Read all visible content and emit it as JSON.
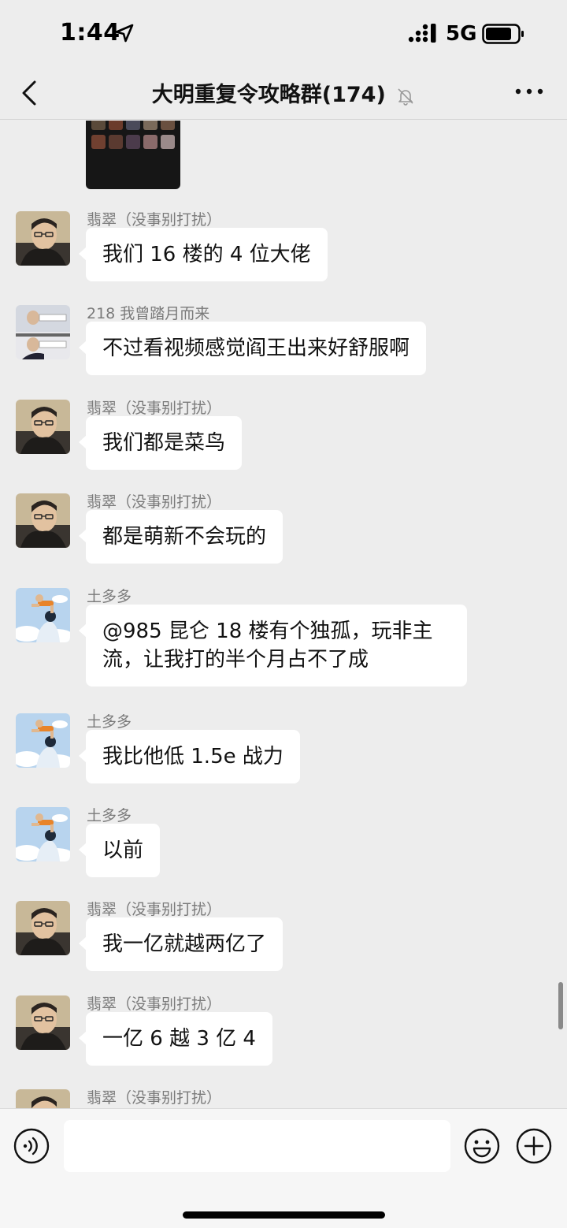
{
  "status_bar": {
    "time": "1:44",
    "network": "5G",
    "icons": [
      "location-arrow-icon",
      "signal-bars-icon",
      "battery-icon"
    ]
  },
  "nav": {
    "back_icon": "chevron-left-icon",
    "title": "大明重复令攻略群(174)",
    "mute_icon": "bell-slash-icon",
    "more_icon": "ellipsis-icon"
  },
  "messages": [
    {
      "sender": "翡翠（没事别打扰）",
      "text": "我们 16 楼的 4 位大佬"
    },
    {
      "sender": "218 我曾踏月而来",
      "text": "不过看视频感觉阎王出来好舒服啊"
    },
    {
      "sender": "翡翠（没事别打扰）",
      "text": "我们都是菜鸟"
    },
    {
      "sender": "翡翠（没事别打扰）",
      "text": "都是萌新不会玩的"
    },
    {
      "sender": "土多多",
      "text": "@985 昆仑 18 楼有个独孤，玩非主流，让我打的半个月占不了成"
    },
    {
      "sender": "土多多",
      "text": "我比他低 1.5e 战力"
    },
    {
      "sender": "土多多",
      "text": "以前"
    },
    {
      "sender": "翡翠（没事别打扰）",
      "text": "我一亿就越两亿了"
    },
    {
      "sender": "翡翠（没事别打扰）",
      "text": "一亿 6 越 3 亿 4"
    },
    {
      "sender": "翡翠（没事别打扰）",
      "text": ""
    }
  ],
  "input_bar": {
    "placeholder": "",
    "icons": [
      "voice-icon",
      "emoji-icon",
      "plus-icon"
    ]
  },
  "colors": {
    "background": "#ededed",
    "bubble": "#ffffff",
    "sender_name": "#7a7a7a",
    "input_bar": "#f6f6f6"
  }
}
